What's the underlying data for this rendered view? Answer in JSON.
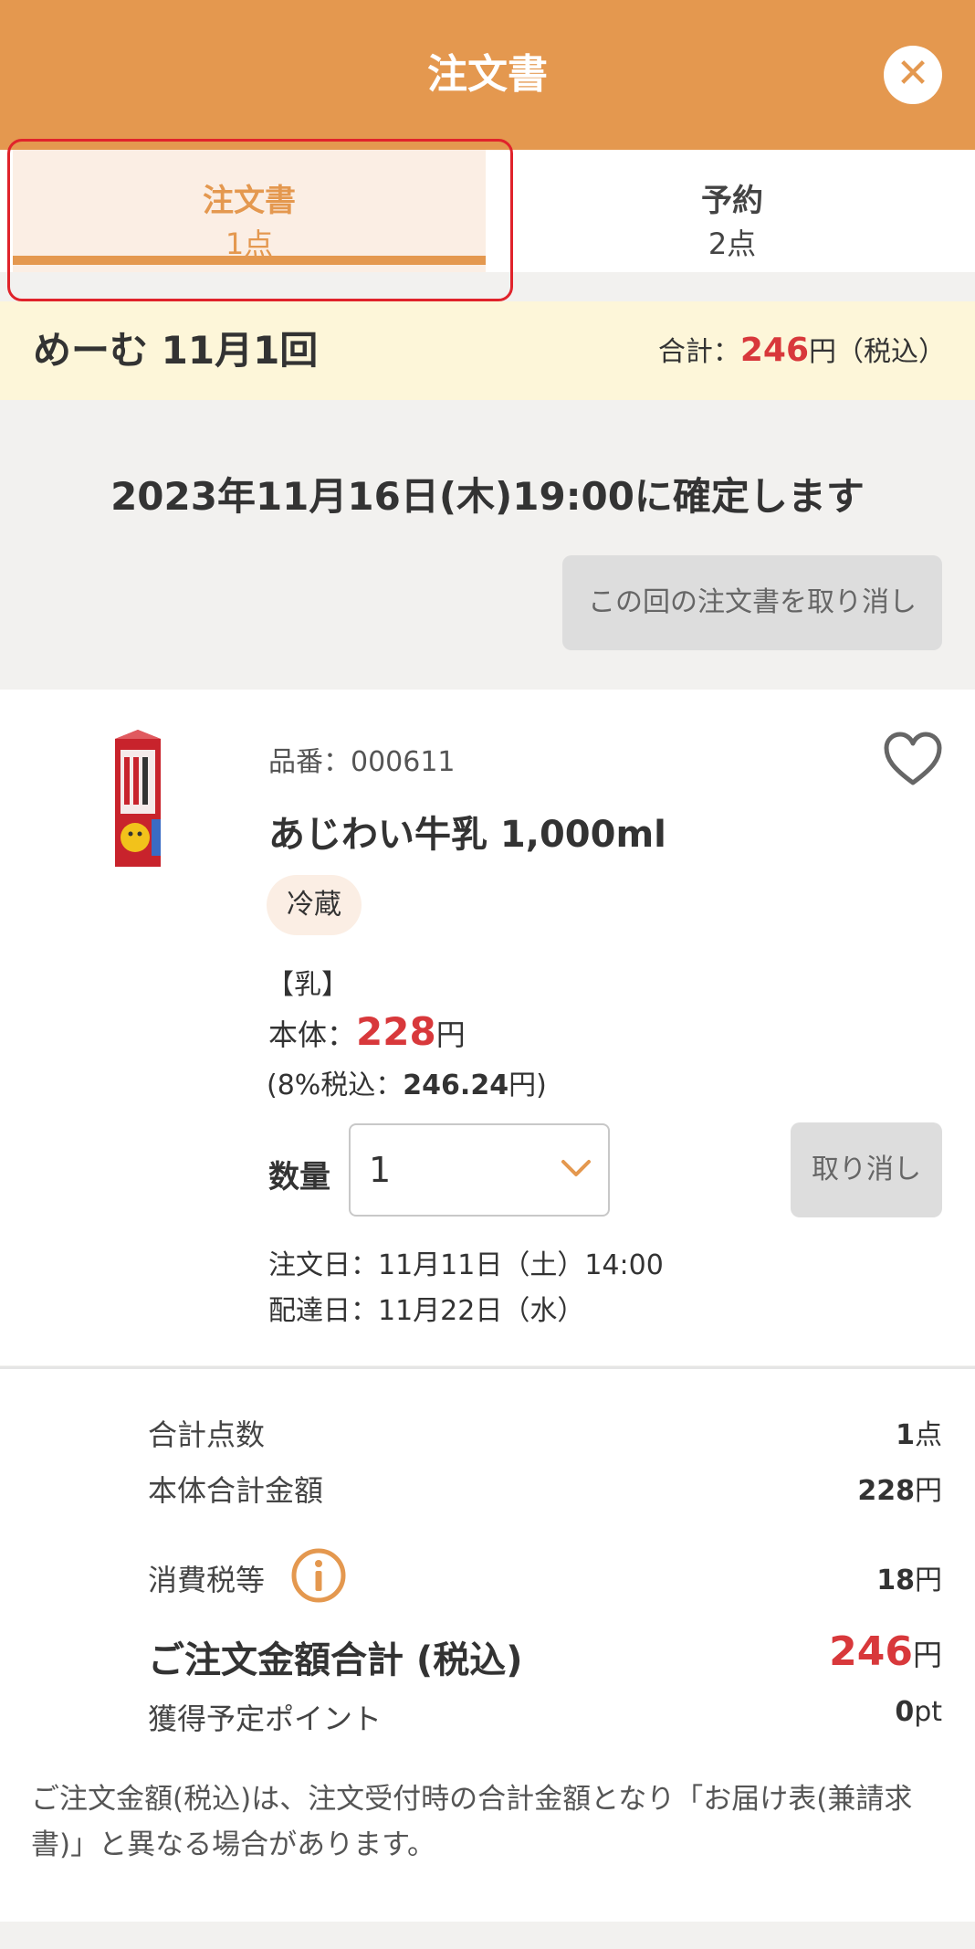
{
  "header": {
    "title": "注文書",
    "close_icon": "close-icon"
  },
  "tabs": [
    {
      "label": "注文書",
      "count": "1点",
      "active": true
    },
    {
      "label": "予約",
      "count": "2点",
      "active": false
    }
  ],
  "summary": {
    "round_label": "めーむ 11月1回",
    "total_prefix": "合計：",
    "total_value": "246",
    "total_suffix": "円（税込）"
  },
  "confirm": {
    "message": "2023年11月16日(木)19:00に確定します",
    "cancel_button": "この回の注文書を取り消し"
  },
  "item": {
    "number": "品番：000611",
    "name": "あじわい牛乳 1,000ml",
    "badge": "冷蔵",
    "allergen": "【乳】",
    "price_prefix": "本体：",
    "price_value": "228",
    "price_unit": "円",
    "tax_prefix": "(8%税込：",
    "tax_value": "246.24",
    "tax_suffix": "円)",
    "qty_label": "数量",
    "qty_value": "1",
    "cancel_button": "取り消し",
    "order_date": "注文日：11月11日（土）14:00",
    "delivery_date": "配達日：11月22日（水）"
  },
  "totals": {
    "count_label": "合計点数",
    "count_value": "1",
    "count_unit": "点",
    "body_label": "本体合計金額",
    "body_value": "228",
    "body_unit": "円",
    "tax_label": "消費税等",
    "tax_value": "18",
    "tax_unit": "円",
    "grand_label": "ご注文金額合計 (税込)",
    "grand_value": "246",
    "grand_unit": "円",
    "points_label": "獲得予定ポイント",
    "points_value": "0",
    "points_unit": "pt"
  },
  "note": "ご注文金額(税込)は、注文受付時の合計金額となり「お届け表(兼請求書)」と異なる場合があります。",
  "colors": {
    "accent": "#e4984f",
    "price_red": "#d8383b",
    "highlight": "#e0232b"
  }
}
